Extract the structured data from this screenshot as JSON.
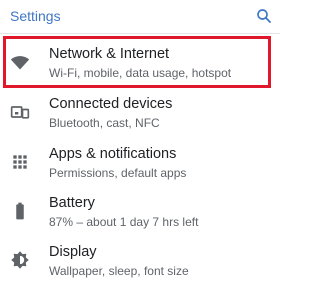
{
  "header": {
    "title": "Settings",
    "search_icon": "search-icon",
    "accent_color": "#3f77c5"
  },
  "items": [
    {
      "title": "Network & Internet",
      "subtitle": "Wi-Fi, mobile, data usage, hotspot",
      "icon": "wifi-icon",
      "highlighted": true
    },
    {
      "title": "Connected devices",
      "subtitle": "Bluetooth, cast, NFC",
      "icon": "devices-icon"
    },
    {
      "title": "Apps & notifications",
      "subtitle": "Permissions, default apps",
      "icon": "apps-grid-icon"
    },
    {
      "title": "Battery",
      "subtitle": "87% – about 1 day 7 hrs left",
      "icon": "battery-icon"
    },
    {
      "title": "Display",
      "subtitle": "Wallpaper, sleep, font size",
      "icon": "brightness-icon"
    }
  ],
  "highlight_color": "#e1182c"
}
